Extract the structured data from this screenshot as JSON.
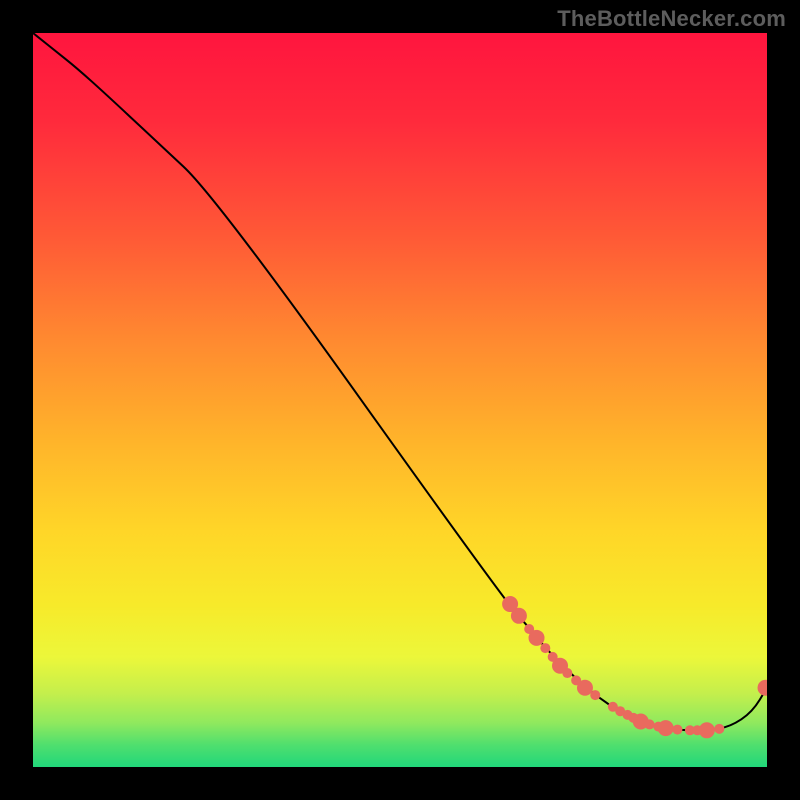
{
  "watermark": "TheBottleNecker.com",
  "chart_data": {
    "type": "line",
    "title": "",
    "xlabel": "",
    "ylabel": "",
    "xlim": [
      0,
      1
    ],
    "ylim": [
      0,
      1
    ],
    "grid": false,
    "legend": false,
    "background_gradient": {
      "top_color": "#ff153e",
      "mid_color": "#ffd628",
      "bottom_color": "#21d77a"
    },
    "series": [
      {
        "name": "bottleneck-curve",
        "color": "#000000",
        "x": [
          0.0,
          0.01,
          0.03,
          0.06,
          0.1,
          0.16,
          0.25,
          0.64,
          0.68,
          0.7,
          0.74,
          0.77,
          0.8,
          0.83,
          0.86,
          0.89,
          0.92,
          0.95,
          0.98,
          1.0
        ],
        "y": [
          1.0,
          0.992,
          0.976,
          0.952,
          0.916,
          0.86,
          0.776,
          0.23,
          0.185,
          0.16,
          0.12,
          0.095,
          0.075,
          0.06,
          0.052,
          0.05,
          0.05,
          0.055,
          0.075,
          0.108
        ]
      }
    ],
    "markers": {
      "name": "highlight-points",
      "color": "#e96a5e",
      "radius_small": 5,
      "radius_large": 8,
      "points": [
        {
          "x": 0.65,
          "y": 0.222,
          "r": "large"
        },
        {
          "x": 0.662,
          "y": 0.206,
          "r": "large"
        },
        {
          "x": 0.676,
          "y": 0.188,
          "r": "small"
        },
        {
          "x": 0.686,
          "y": 0.176,
          "r": "large"
        },
        {
          "x": 0.698,
          "y": 0.162,
          "r": "small"
        },
        {
          "x": 0.708,
          "y": 0.15,
          "r": "small"
        },
        {
          "x": 0.718,
          "y": 0.138,
          "r": "large"
        },
        {
          "x": 0.728,
          "y": 0.128,
          "r": "small"
        },
        {
          "x": 0.74,
          "y": 0.118,
          "r": "small"
        },
        {
          "x": 0.752,
          "y": 0.108,
          "r": "large"
        },
        {
          "x": 0.766,
          "y": 0.098,
          "r": "small"
        },
        {
          "x": 0.79,
          "y": 0.082,
          "r": "small"
        },
        {
          "x": 0.8,
          "y": 0.076,
          "r": "small"
        },
        {
          "x": 0.81,
          "y": 0.071,
          "r": "small"
        },
        {
          "x": 0.818,
          "y": 0.067,
          "r": "small"
        },
        {
          "x": 0.828,
          "y": 0.062,
          "r": "large"
        },
        {
          "x": 0.84,
          "y": 0.058,
          "r": "small"
        },
        {
          "x": 0.852,
          "y": 0.055,
          "r": "small"
        },
        {
          "x": 0.862,
          "y": 0.053,
          "r": "large"
        },
        {
          "x": 0.878,
          "y": 0.051,
          "r": "small"
        },
        {
          "x": 0.895,
          "y": 0.05,
          "r": "small"
        },
        {
          "x": 0.905,
          "y": 0.05,
          "r": "small"
        },
        {
          "x": 0.918,
          "y": 0.05,
          "r": "large"
        },
        {
          "x": 0.935,
          "y": 0.052,
          "r": "small"
        },
        {
          "x": 0.998,
          "y": 0.108,
          "r": "large"
        }
      ]
    }
  }
}
